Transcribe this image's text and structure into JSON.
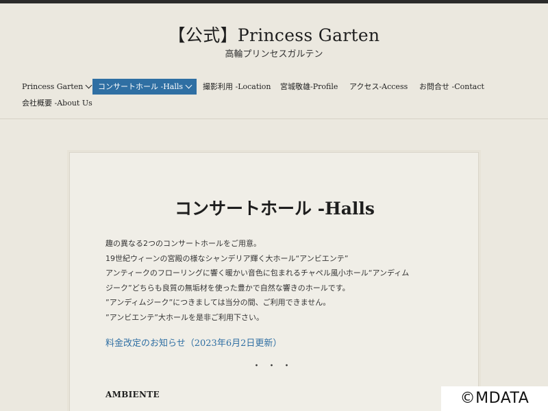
{
  "header": {
    "site_title": "【公式】Princess Garten",
    "site_subtitle": "高輪プリンセスガルテン"
  },
  "nav": {
    "items": [
      {
        "label": "Princess Garten",
        "has_dropdown": true,
        "active": false
      },
      {
        "label": "コンサートホール -Halls",
        "has_dropdown": true,
        "active": true
      },
      {
        "label": "撮影利用 -Location",
        "has_dropdown": false,
        "active": false
      },
      {
        "label": "宮城敬雄-Profile",
        "has_dropdown": false,
        "active": false
      },
      {
        "label": "アクセス-Access",
        "has_dropdown": false,
        "active": false
      },
      {
        "label": "お問合せ -Contact",
        "has_dropdown": false,
        "active": false
      },
      {
        "label": "会社概要 -About Us",
        "has_dropdown": false,
        "active": false
      }
    ],
    "active_color": "#2f6fa3"
  },
  "main": {
    "title": "コンサートホール -Halls",
    "paragraph_lines": [
      "趣の異なる2つのコンサートホールをご用意。",
      "19世紀ウィーンの宮殿の様なシャンデリア輝く大ホール“アンビエンテ”",
      "アンティークのフローリングに響く暖かい音色に包まれるチャペル風小ホール“アンディム",
      "ジーク”どちらも良質の無垢材を使った豊かで自然な響きのホールです。",
      "”アンディムジーク”につきましては当分の間、ご利用できません。",
      "”アンビエンテ”大ホールを是非ご利用下さい。"
    ],
    "notice_link": "料金改定のお知らせ（2023年6月2日更新）",
    "separator": "・・・",
    "section_heading": "AMBIENTE"
  },
  "watermark": "©MDATA",
  "colors": {
    "background": "#ebe8df",
    "card": "#f0eee7",
    "link": "#2f6fa3"
  }
}
